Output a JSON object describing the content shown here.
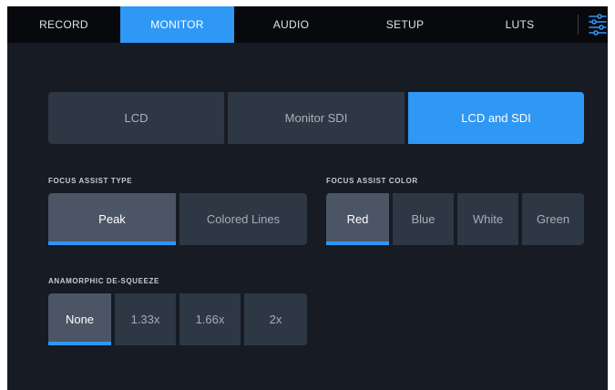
{
  "tabs": {
    "record": "RECORD",
    "monitor": "MONITOR",
    "audio": "AUDIO",
    "setup": "SETUP",
    "luts": "LUTS",
    "active": "MONITOR",
    "settings_icon": "sliders-icon"
  },
  "output": {
    "options": [
      "LCD",
      "Monitor SDI",
      "LCD and SDI"
    ],
    "selected": "LCD and SDI"
  },
  "focus_assist_type": {
    "label": "FOCUS ASSIST TYPE",
    "options": [
      "Peak",
      "Colored Lines"
    ],
    "selected": "Peak"
  },
  "focus_assist_color": {
    "label": "FOCUS ASSIST COLOR",
    "options": [
      "Red",
      "Blue",
      "White",
      "Green"
    ],
    "selected": "Red"
  },
  "anamorphic": {
    "label": "ANAMORPHIC DE-SQUEEZE",
    "options": [
      "None",
      "1.33x",
      "1.66x",
      "2x"
    ],
    "selected": "None"
  },
  "colors": {
    "accent": "#2f97f4",
    "background": "#161b24",
    "tabbar": "#07090d",
    "button": "#2e3744",
    "button_selected": "#4b5566"
  }
}
